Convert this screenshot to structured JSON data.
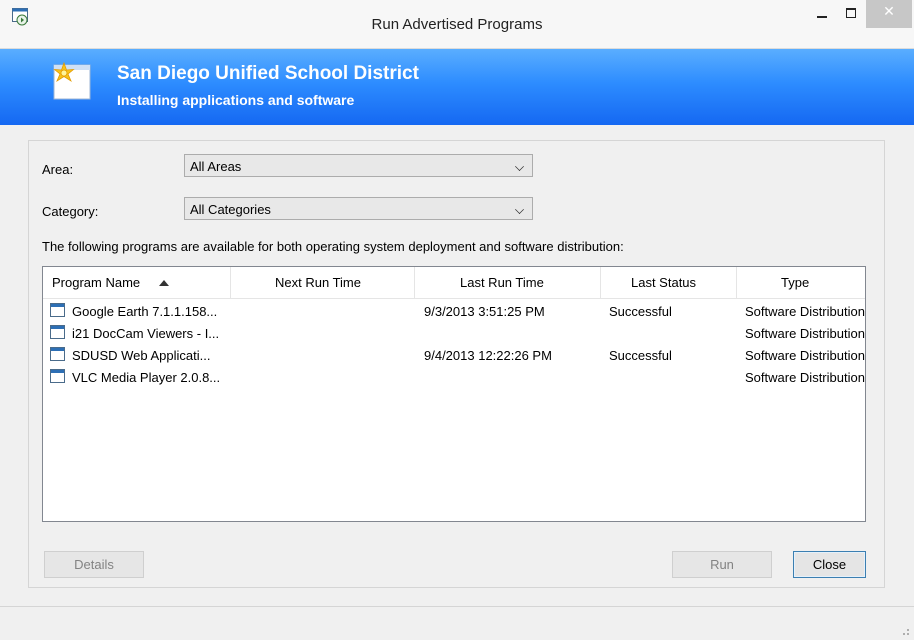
{
  "window": {
    "title": "Run Advertised Programs",
    "close_glyph": "✕",
    "icons": {
      "app": "program-window-icon",
      "minimize": "minimize-icon",
      "maximize": "maximize-icon",
      "close": "close-icon"
    }
  },
  "banner": {
    "title": "San Diego Unified School District",
    "subtitle": "Installing applications and software",
    "icon": "sunburst-document-icon"
  },
  "filters": {
    "area_label": "Area:",
    "area_value": "All Areas",
    "category_label": "Category:",
    "category_value": "All Categories"
  },
  "info_text": "The following programs are available for both operating system deployment and software distribution:",
  "table": {
    "columns": [
      "Program Name",
      "Next Run Time",
      "Last Run Time",
      "Last Status",
      "Type"
    ],
    "sorted_column": "Program Name",
    "sort_direction": "ascending",
    "rows": [
      {
        "name": "Google Earth 7.1.1.158...",
        "next_run": "",
        "last_run": "9/3/2013 3:51:25 PM",
        "status": "Successful",
        "type": "Software Distribution"
      },
      {
        "name": "i21 DocCam Viewers - I...",
        "next_run": "",
        "last_run": "",
        "status": "",
        "type": "Software Distribution"
      },
      {
        "name": "SDUSD Web Applicati...",
        "next_run": "",
        "last_run": "9/4/2013 12:22:26 PM",
        "status": "Successful",
        "type": "Software Distribution"
      },
      {
        "name": "VLC Media Player 2.0.8...",
        "next_run": "",
        "last_run": "",
        "status": "",
        "type": "Software Distribution"
      }
    ]
  },
  "buttons": {
    "details": "Details",
    "run": "Run",
    "close": "Close"
  },
  "colors": {
    "banner_top": "#5aaeff",
    "banner_bottom": "#1568f2",
    "close_button": "#c7c7c7"
  }
}
